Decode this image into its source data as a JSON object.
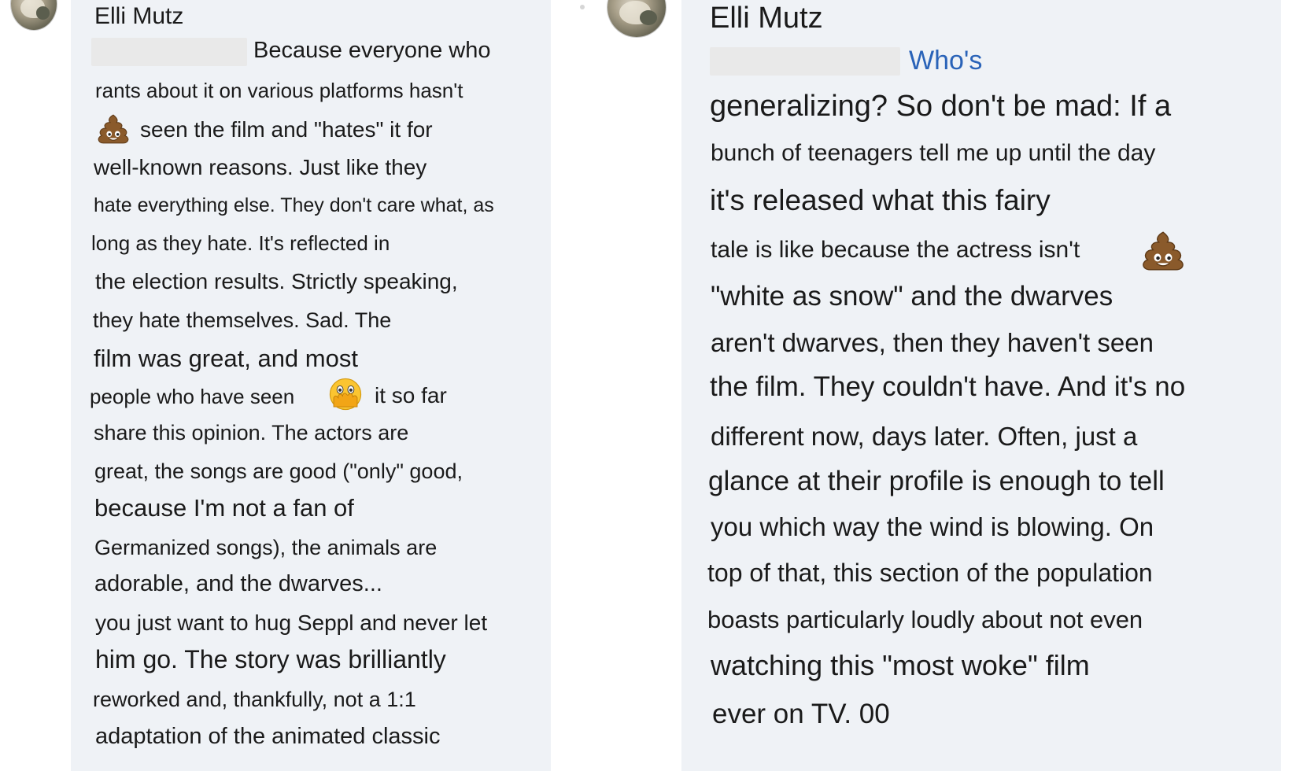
{
  "left": {
    "author": "Elli Mutz",
    "lines": [
      "Because everyone who",
      "rants about it on various platforms hasn't",
      "seen the film and \"hates\" it for",
      "well-known reasons. Just like they",
      "hate everything else. They don't care what, as",
      "long as they hate. It's reflected in",
      "the election results. Strictly speaking,",
      "they hate themselves. Sad. The",
      "film was great, and most",
      "people who have seen",
      "it so far",
      "share this opinion. The actors are",
      "great, the songs are good (\"only\" good,",
      "because I'm not a fan of",
      "Germanized songs), the animals are",
      "adorable, and the dwarves...",
      "you just want to hug Seppl and never let",
      "him go. The story was brilliantly",
      "reworked and, thankfully, not a 1:1",
      "adaptation of the animated classic"
    ]
  },
  "right": {
    "author": "Elli Mutz",
    "mention": "Who's",
    "lines": [
      "generalizing? So don't be mad: If a",
      "bunch of teenagers tell me up until the day",
      "it's released what this fairy",
      "tale is like because the actress isn't",
      "\"white as snow\" and the dwarves",
      "aren't dwarves, then they haven't seen",
      "the film. They couldn't have. And it's no",
      "different now, days later. Often, just a",
      "glance at their profile is enough to tell",
      "you which way the wind is blowing. On",
      "top of that, this section of the population",
      "boasts particularly loudly about not even",
      "watching this \"most woke\" film",
      "ever on TV. 00"
    ]
  },
  "icons": {
    "poop": "pile-of-poo-icon",
    "peek": "face-with-open-eyes-and-hand-over-mouth-icon"
  }
}
